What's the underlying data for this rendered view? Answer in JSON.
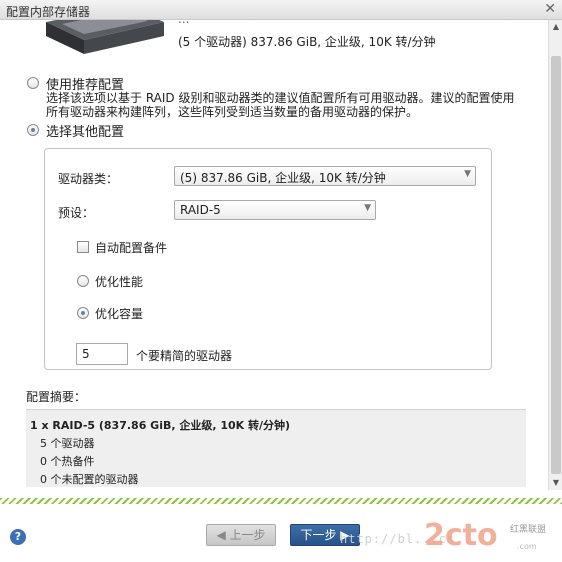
{
  "window": {
    "title": "配置内部存储器",
    "close_glyph": "✕"
  },
  "top": {
    "disk_stub_text": "...",
    "disk_summary": "(5 个驱动器) 837.86 GiB, 企业级, 10K 转/分钟"
  },
  "options": {
    "recommended": {
      "label": "使用推荐配置",
      "description": "选择该选项以基于 RAID 级别和驱动器类的建议值配置所有可用驱动器。建议的配置使用所有驱动器来构建阵列，这些阵列受到适当数量的备用驱动器的保护。",
      "selected": false
    },
    "other": {
      "label": "选择其他配置",
      "selected": true
    }
  },
  "group": {
    "drive_class_label": "驱动器类：",
    "drive_class_value": "(5) 837.86 GiB, 企业级, 10K 转/分钟",
    "preset_label": "预设：",
    "preset_value": "RAID-5",
    "auto_spares_label": "自动配置备件",
    "auto_spares_checked": false,
    "optimize": [
      {
        "label": "优化性能",
        "selected": false
      },
      {
        "label": "优化容量",
        "selected": true
      }
    ],
    "drive_count_value": "5",
    "drive_count_label": "个要精简的驱动器"
  },
  "summary": {
    "label": "配置摘要：",
    "lines": [
      "1 x RAID-5 (837.86 GiB, 企业级, 10K 转/分钟)",
      "5 个驱动器",
      "0 个热备件",
      "0 个未配置的驱动器"
    ]
  },
  "footer": {
    "help_glyph": "?",
    "prev_label": "◀ 上一步",
    "next_label": "下一步 ▶",
    "watermark_url": "http://bl...cs...",
    "watermark_logo": "2cto",
    "watermark_tag": "红黑联盟",
    "watermark_tag2": ".com"
  },
  "colors": {
    "accent": "#2f5f9c",
    "divider_green": "#8dc63f"
  }
}
